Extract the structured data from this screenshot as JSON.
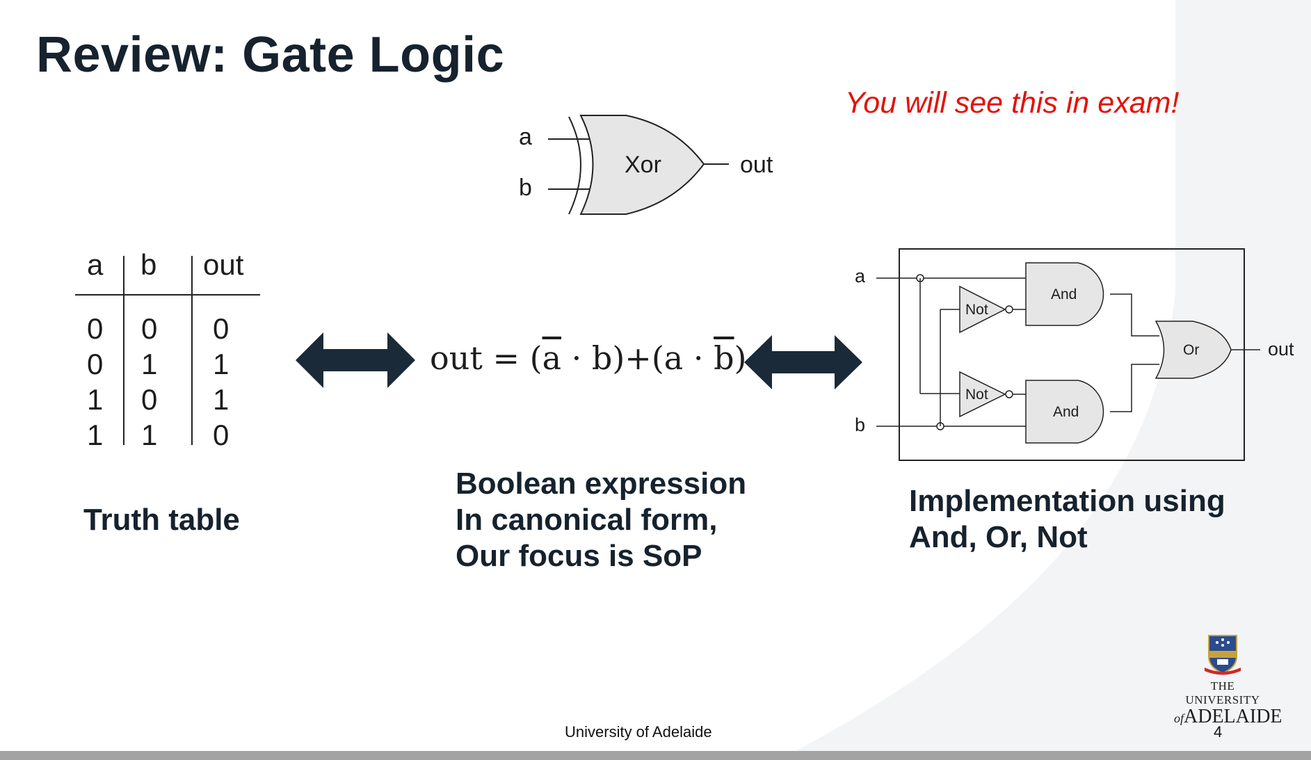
{
  "slide": {
    "title": "Review: Gate Logic",
    "exam_note": "You will see this in exam!",
    "page_number": "4",
    "footer": "University of Adelaide"
  },
  "xor_gate": {
    "input_a": "a",
    "input_b": "b",
    "gate_label": "Xor",
    "output": "out"
  },
  "truth_table": {
    "headers": [
      "a",
      "b",
      "out"
    ],
    "rows": [
      [
        "0",
        "0",
        "0"
      ],
      [
        "0",
        "1",
        "1"
      ],
      [
        "1",
        "0",
        "1"
      ],
      [
        "1",
        "1",
        "0"
      ]
    ],
    "caption": "Truth table"
  },
  "expression": {
    "lhs": "out",
    "eq": "=",
    "t1_open": "(",
    "t1_var1": "a",
    "t1_dot": "·",
    "t1_var2": "b",
    "t1_close": ")",
    "plus": "+",
    "t2_open": "(",
    "t2_var1": "a",
    "t2_dot": "·",
    "t2_var2": "b",
    "t2_close": ")",
    "caption_lines": [
      "Boolean expression",
      "In canonical form,",
      "Our focus is SoP"
    ]
  },
  "circuit": {
    "input_a": "a",
    "input_b": "b",
    "not_top": "Not",
    "not_bottom": "Not",
    "and_top": "And",
    "and_bottom": "And",
    "or_gate": "Or",
    "output": "out",
    "caption_lines": [
      "Implementation using",
      "And, Or, Not"
    ]
  },
  "logo": {
    "line1": "THE UNIVERSITY",
    "line2_prefix": "of",
    "line2": "ADELAIDE"
  },
  "colors": {
    "title": "#16222e",
    "accent_red": "#e3120b",
    "arrow": "#1b2a38",
    "gate_fill": "#e6e6e6"
  }
}
